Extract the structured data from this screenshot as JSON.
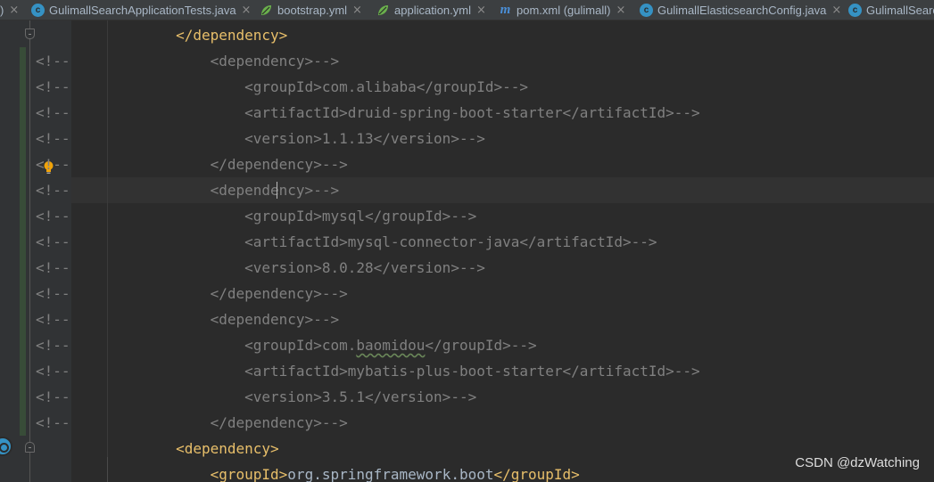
{
  "tabs": [
    {
      "label": ")",
      "icon": "none",
      "close": "×"
    },
    {
      "label": "GulimallSearchApplicationTests.java",
      "icon": "java-class-icon",
      "close": "×"
    },
    {
      "label": "bootstrap.yml",
      "icon": "yaml-leaf-icon",
      "close": "×"
    },
    {
      "label": "application.yml",
      "icon": "yaml-leaf-icon",
      "close": "×"
    },
    {
      "label": "pom.xml (gulimall)",
      "icon": "maven-icon",
      "close": "×"
    },
    {
      "label": "GulimallElasticsearchConfig.java",
      "icon": "java-class-icon",
      "close": "×"
    },
    {
      "label": "GulimallSearc",
      "icon": "java-class-icon",
      "close": ""
    }
  ],
  "editor": {
    "lines": [
      {
        "prefix": "",
        "indent": "        ",
        "parts": [
          {
            "k": "tag",
            "t": "</dependency>"
          }
        ]
      },
      {
        "prefix": "<!--",
        "indent": "            ",
        "parts": [
          {
            "k": "cm",
            "t": "<dependency>-->"
          }
        ]
      },
      {
        "prefix": "<!--",
        "indent": "                ",
        "parts": [
          {
            "k": "cm",
            "t": "<groupId>com.alibaba</groupId>-->"
          }
        ]
      },
      {
        "prefix": "<!--",
        "indent": "                ",
        "parts": [
          {
            "k": "cm",
            "t": "<artifactId>druid-spring-boot-starter</artifactId>-->"
          }
        ]
      },
      {
        "prefix": "<!--",
        "indent": "                ",
        "parts": [
          {
            "k": "cm",
            "t": "<version>1.1.13</version>-->"
          }
        ]
      },
      {
        "prefix": "<!--",
        "indent": "            ",
        "parts": [
          {
            "k": "cm",
            "t": "</dependency>-->"
          }
        ]
      },
      {
        "prefix": "<!--",
        "indent": "            ",
        "parts": [
          {
            "k": "cm",
            "t": "<dependency>-->"
          }
        ]
      },
      {
        "prefix": "<!--",
        "indent": "                ",
        "parts": [
          {
            "k": "cm",
            "t": "<groupId>mysql</groupId>-->"
          }
        ]
      },
      {
        "prefix": "<!--",
        "indent": "                ",
        "parts": [
          {
            "k": "cm",
            "t": "<artifactId>mysql-connector-java</artifactId>-->"
          }
        ]
      },
      {
        "prefix": "<!--",
        "indent": "                ",
        "parts": [
          {
            "k": "cm",
            "t": "<version>8.0.28</version>-->"
          }
        ]
      },
      {
        "prefix": "<!--",
        "indent": "            ",
        "parts": [
          {
            "k": "cm",
            "t": "</dependency>-->"
          }
        ]
      },
      {
        "prefix": "<!--",
        "indent": "            ",
        "parts": [
          {
            "k": "cm",
            "t": "<dependency>-->"
          }
        ]
      },
      {
        "prefix": "<!--",
        "indent": "                ",
        "parts": [
          {
            "k": "cm",
            "t": "<groupId>com."
          },
          {
            "k": "cm typo",
            "t": "baomidou"
          },
          {
            "k": "cm",
            "t": "</groupId>-->"
          }
        ]
      },
      {
        "prefix": "<!--",
        "indent": "                ",
        "parts": [
          {
            "k": "cm",
            "t": "<artifactId>mybatis-plus-boot-starter</artifactId>-->"
          }
        ]
      },
      {
        "prefix": "<!--",
        "indent": "                ",
        "parts": [
          {
            "k": "cm",
            "t": "<version>3.5.1</version>-->"
          }
        ]
      },
      {
        "prefix": "<!--",
        "indent": "            ",
        "parts": [
          {
            "k": "cm",
            "t": "</dependency>-->"
          }
        ]
      },
      {
        "prefix": "",
        "indent": "        ",
        "parts": [
          {
            "k": "tag",
            "t": "<dependency>"
          }
        ]
      },
      {
        "prefix": "",
        "indent": "            ",
        "parts": [
          {
            "k": "tag",
            "t": "<groupId>"
          },
          {
            "k": "txt",
            "t": "org.springframework.boot"
          },
          {
            "k": "tag",
            "t": "</groupId>"
          }
        ]
      }
    ]
  },
  "watermark": "CSDN @dzWatching",
  "colors": {
    "background": "#2b2b2b",
    "tag": "#e8bf6a",
    "comment": "#808080",
    "text": "#a9b7c6",
    "gutter": "#313335",
    "current_line": "#323232"
  }
}
